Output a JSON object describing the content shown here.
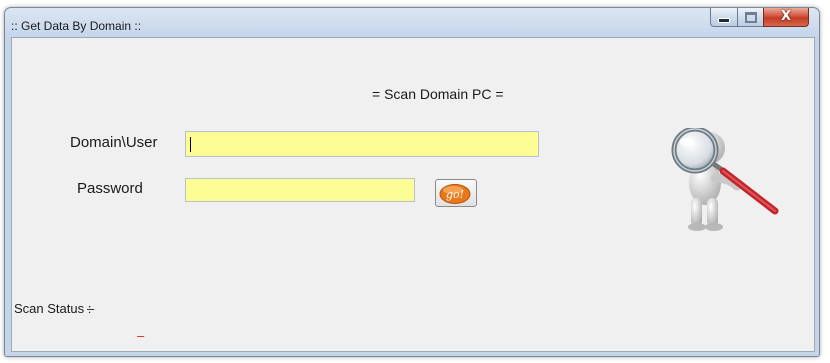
{
  "window": {
    "title": ":: Get Data By Domain ::",
    "controls": {
      "minimize": "minimize",
      "maximize": "maximize",
      "close_glyph": "X"
    }
  },
  "form": {
    "heading": "= Scan Domain PC =",
    "domain_user": {
      "label": "Domain\\User",
      "value": ""
    },
    "password": {
      "label": "Password",
      "value": ""
    },
    "go_button": {
      "text": "go!"
    }
  },
  "status": {
    "label": "Scan Status  :",
    "value": "–",
    "detail": "–"
  },
  "colors": {
    "field_bg": "#fdfd96",
    "status_red": "#e02020",
    "go_orange": "#f08a24"
  },
  "icons": [
    "magnifier-figure-icon",
    "minimize-icon",
    "maximize-icon",
    "close-icon"
  ]
}
